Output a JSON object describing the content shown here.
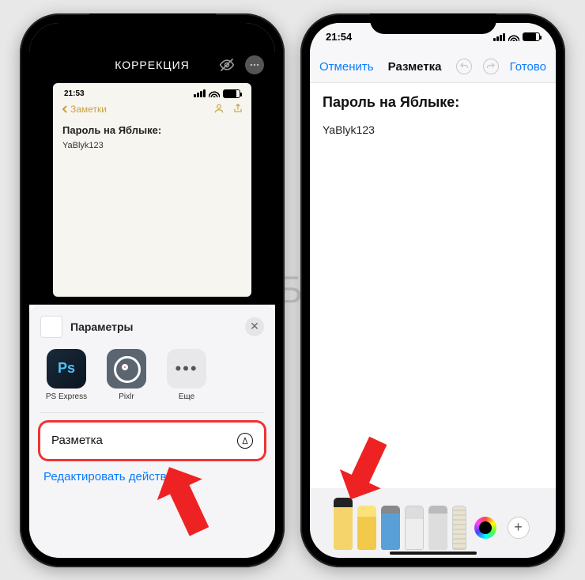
{
  "watermark": "ЯБЛЫК",
  "phone1": {
    "status_time": "21:53",
    "header_title": "КОРРЕКЦИЯ",
    "note": {
      "time": "21:53",
      "back_label": "Заметки",
      "title": "Пароль на Яблыке:",
      "body": "YaBlyk123"
    },
    "sheet": {
      "title": "Параметры",
      "apps": [
        {
          "label": "PS Express"
        },
        {
          "label": "Pixlr"
        },
        {
          "label": "Еще"
        }
      ],
      "actions": {
        "markup": "Разметка",
        "edit": "Редактировать действия…"
      }
    }
  },
  "phone2": {
    "status_time": "21:54",
    "cancel": "Отменить",
    "title": "Разметка",
    "done": "Готово",
    "content_title": "Пароль на Яблыке:",
    "content_body": "YaBlyk123"
  }
}
